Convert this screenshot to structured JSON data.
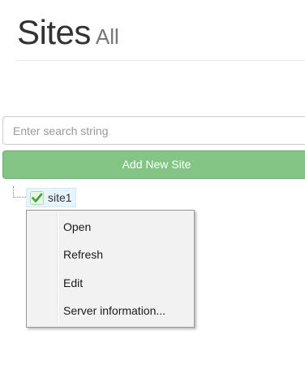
{
  "header": {
    "title": "Sites",
    "subtitle": "All"
  },
  "search": {
    "placeholder": "Enter search string",
    "value": ""
  },
  "actions": {
    "add_label": "Add New Site"
  },
  "tree": {
    "nodes": [
      {
        "label": "site1",
        "icon": "green-check-icon",
        "selected": true
      }
    ]
  },
  "context_menu": {
    "items": [
      {
        "label": "Open"
      },
      {
        "label": "Refresh"
      },
      {
        "label": "Edit"
      },
      {
        "label": "Server information..."
      }
    ]
  },
  "colors": {
    "add_button": "#84c484",
    "node_highlight": "#e8f4fb",
    "check_green": "#3aa33a"
  }
}
